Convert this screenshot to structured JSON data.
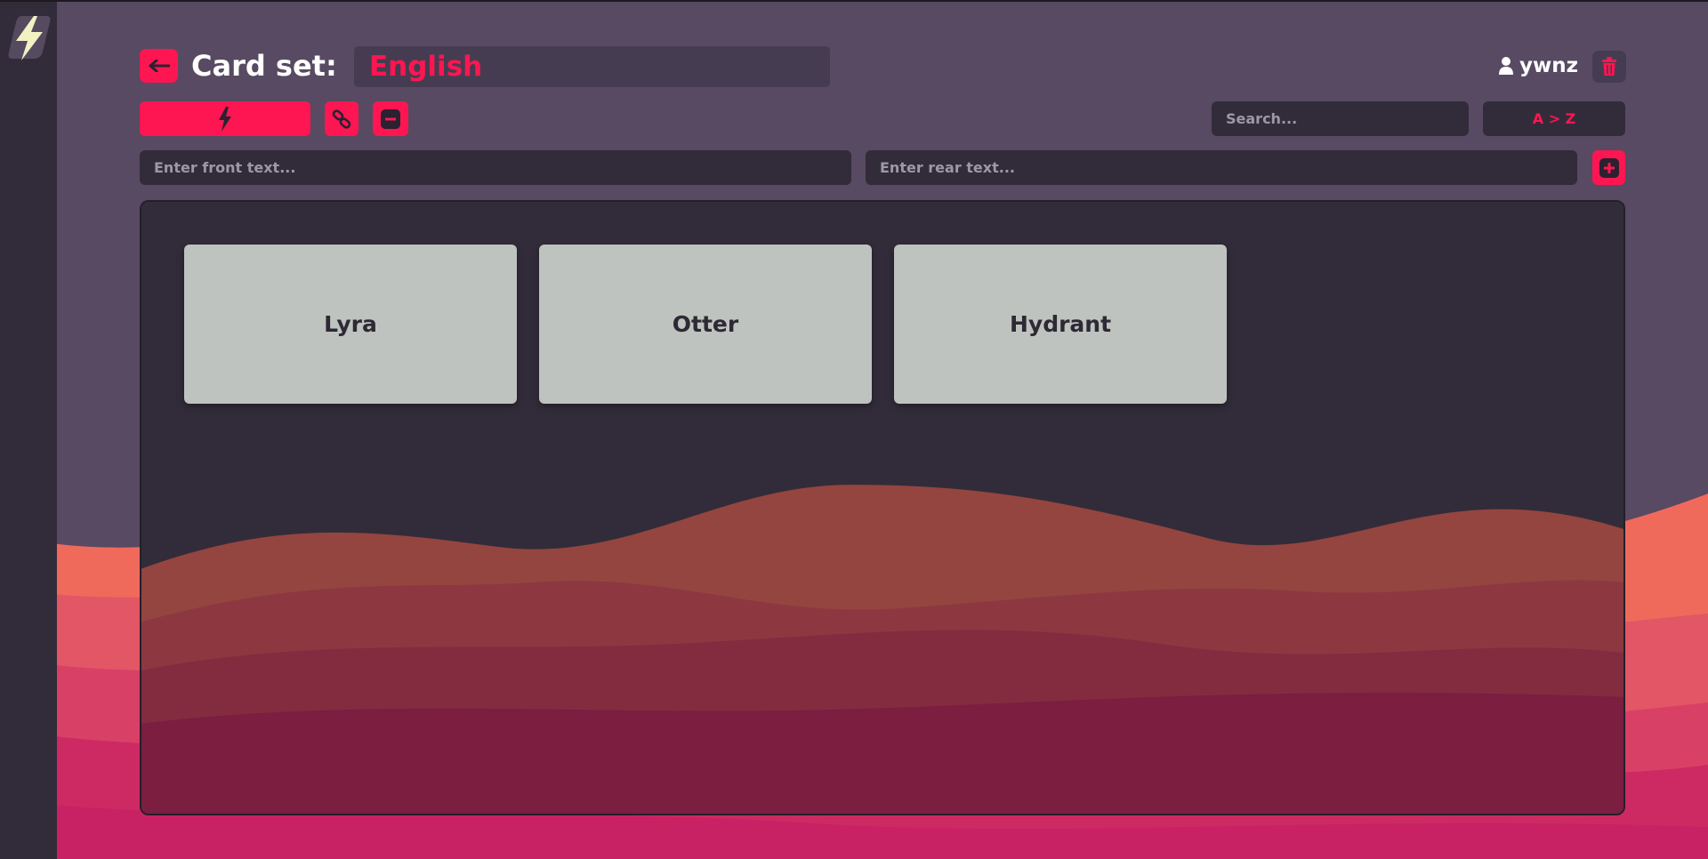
{
  "header": {
    "title_label": "Card set:",
    "set_name": "English",
    "username": "ywnz"
  },
  "toolbar": {
    "search_placeholder": "Search...",
    "sort_label": "A > Z"
  },
  "entry": {
    "front_placeholder": "Enter front text...",
    "rear_placeholder": "Enter rear text..."
  },
  "cards": [
    {
      "label": "Lyra"
    },
    {
      "label": "Otter"
    },
    {
      "label": "Hydrant"
    }
  ],
  "icons": {
    "logo": "lightning-logo-icon",
    "back": "arrow-left-icon",
    "user": "user-icon",
    "delete": "trash-icon",
    "study": "lightning-icon",
    "link": "link-icon",
    "remove": "minus-square-icon",
    "add": "plus-square-icon"
  },
  "colors": {
    "accent": "#fd1651",
    "background": "#574a62",
    "sidebar": "#322c3a",
    "panel": "#322c3a",
    "card": "#bfc3bf"
  }
}
